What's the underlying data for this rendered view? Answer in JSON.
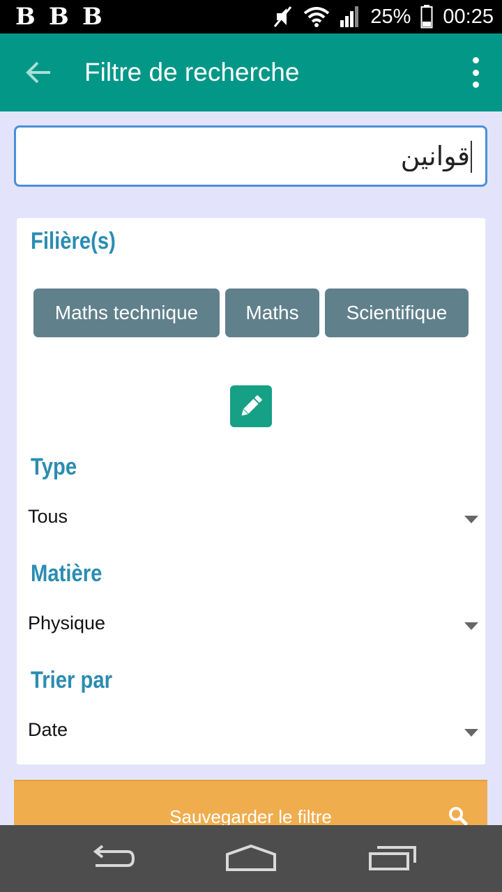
{
  "status_bar": {
    "notification_icons": [
      "b-app-icon",
      "b-app-icon",
      "b-app-icon"
    ],
    "notification_glyph": "B",
    "battery": "25%",
    "time": "00:25"
  },
  "app_bar": {
    "title": "Filtre de recherche"
  },
  "search": {
    "value": "قوانين"
  },
  "filters": {
    "filieres_title": "Filière(s)",
    "filieres": [
      "Maths technique",
      "Maths",
      "Scientifique"
    ],
    "type_title": "Type",
    "type_value": "Tous",
    "matiere_title": "Matière",
    "matiere_value": "Physique",
    "sort_title": "Trier par",
    "sort_value": "Date"
  },
  "save_button": {
    "label": "Sauvegarder le filtre"
  },
  "colors": {
    "app_bar": "#029787",
    "section_title": "#2b8cb1",
    "chip": "#60808c",
    "edit_button": "#16a085",
    "save_button": "#f0ad4e",
    "background": "#e3e4fb"
  }
}
